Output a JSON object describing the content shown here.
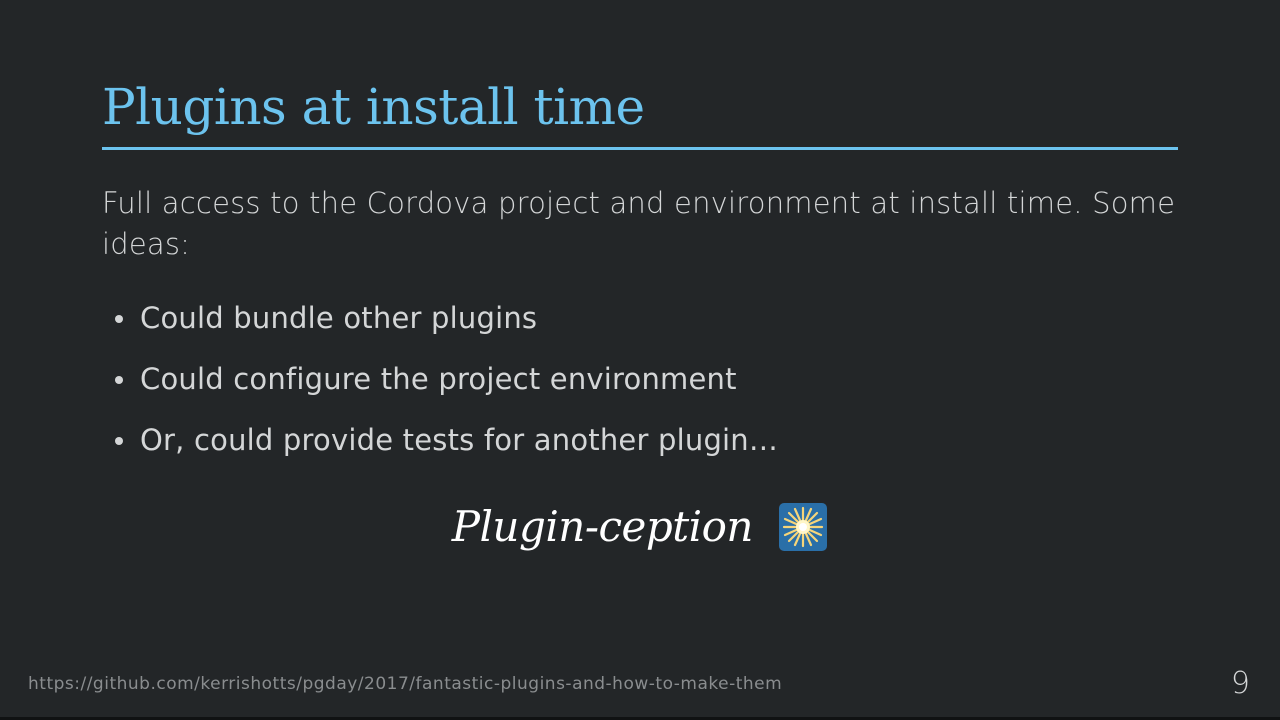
{
  "slide": {
    "title": "Plugins at install time",
    "intro": "Full access to the Cordova project and environment at install time. Some ideas:",
    "bullets": [
      "Could bundle other plugins",
      "Could configure the project environment",
      "Or, could provide tests for another plugin…"
    ],
    "tagline": "Plugin-ception",
    "tagline_icon": "sparkle-icon",
    "footer_url": "https://github.com/kerrishotts/pgday/2017/fantastic-plugins-and-how-to-make-them",
    "page_number": "9"
  },
  "colors": {
    "background": "#232628",
    "accent": "#6cc3ee",
    "text": "#d4d6d7",
    "footer_text": "#8a8d8f"
  }
}
